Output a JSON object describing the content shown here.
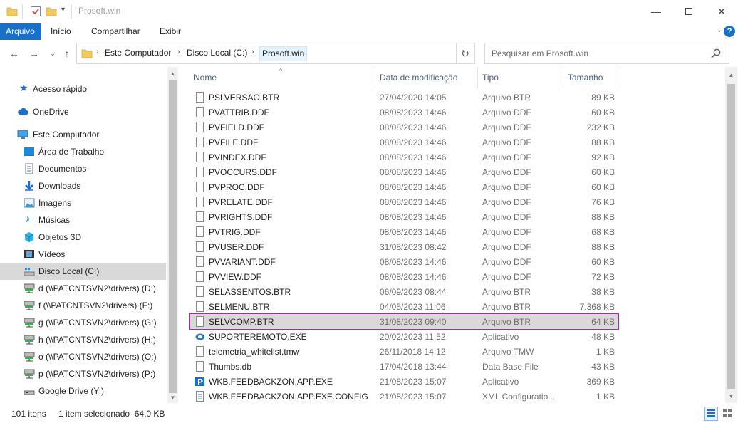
{
  "window": {
    "title": "Prosoft.win"
  },
  "ribbon": {
    "tabs": [
      "Arquivo",
      "Início",
      "Compartilhar",
      "Exibir"
    ]
  },
  "address": {
    "crumbs": [
      "Este Computador",
      "Disco Local (C:)",
      "Prosoft.win"
    ],
    "search_placeholder": "Pesquisar em Prosoft.win"
  },
  "nav": {
    "items": [
      {
        "label": "Acesso rápido",
        "icon": "star-icon"
      },
      {
        "label": "OneDrive",
        "icon": "cloud-icon"
      },
      {
        "label": "Este Computador",
        "icon": "computer-icon"
      },
      {
        "label": "Área de Trabalho",
        "icon": "desktop-icon"
      },
      {
        "label": "Documentos",
        "icon": "document-icon"
      },
      {
        "label": "Downloads",
        "icon": "download-icon"
      },
      {
        "label": "Imagens",
        "icon": "image-icon"
      },
      {
        "label": "Músicas",
        "icon": "music-icon"
      },
      {
        "label": "Objetos 3D",
        "icon": "cube-icon"
      },
      {
        "label": "Vídeos",
        "icon": "video-icon"
      },
      {
        "label": "Disco Local (C:)",
        "icon": "drive-icon"
      },
      {
        "label": "d (\\\\PATCNTSVN2\\drivers) (D:)",
        "icon": "network-drive-icon"
      },
      {
        "label": "f (\\\\PATCNTSVN2\\drivers) (F:)",
        "icon": "network-drive-icon"
      },
      {
        "label": "g (\\\\PATCNTSVN2\\drivers) (G:)",
        "icon": "network-drive-icon"
      },
      {
        "label": "h (\\\\PATCNTSVN2\\drivers) (H:)",
        "icon": "network-drive-icon"
      },
      {
        "label": "o (\\\\PATCNTSVN2\\drivers) (O:)",
        "icon": "network-drive-icon"
      },
      {
        "label": "p (\\\\PATCNTSVN2\\drivers) (P:)",
        "icon": "network-drive-icon"
      },
      {
        "label": "Google Drive (Y:)",
        "icon": "drive-icon"
      }
    ]
  },
  "columns": {
    "name": "Nome",
    "date": "Data de modificação",
    "type": "Tipo",
    "size": "Tamanho"
  },
  "files": [
    {
      "name": "PSLVERSAO.BTR",
      "date": "27/04/2020 14:05",
      "type": "Arquivo BTR",
      "size": "89 KB"
    },
    {
      "name": "PVATTRIB.DDF",
      "date": "08/08/2023 14:46",
      "type": "Arquivo DDF",
      "size": "60 KB"
    },
    {
      "name": "PVFIELD.DDF",
      "date": "08/08/2023 14:46",
      "type": "Arquivo DDF",
      "size": "232 KB"
    },
    {
      "name": "PVFILE.DDF",
      "date": "08/08/2023 14:46",
      "type": "Arquivo DDF",
      "size": "88 KB"
    },
    {
      "name": "PVINDEX.DDF",
      "date": "08/08/2023 14:46",
      "type": "Arquivo DDF",
      "size": "92 KB"
    },
    {
      "name": "PVOCCURS.DDF",
      "date": "08/08/2023 14:46",
      "type": "Arquivo DDF",
      "size": "60 KB"
    },
    {
      "name": "PVPROC.DDF",
      "date": "08/08/2023 14:46",
      "type": "Arquivo DDF",
      "size": "60 KB"
    },
    {
      "name": "PVRELATE.DDF",
      "date": "08/08/2023 14:46",
      "type": "Arquivo DDF",
      "size": "76 KB"
    },
    {
      "name": "PVRIGHTS.DDF",
      "date": "08/08/2023 14:46",
      "type": "Arquivo DDF",
      "size": "88 KB"
    },
    {
      "name": "PVTRIG.DDF",
      "date": "08/08/2023 14:46",
      "type": "Arquivo DDF",
      "size": "68 KB"
    },
    {
      "name": "PVUSER.DDF",
      "date": "31/08/2023 08:42",
      "type": "Arquivo DDF",
      "size": "88 KB"
    },
    {
      "name": "PVVARIANT.DDF",
      "date": "08/08/2023 14:46",
      "type": "Arquivo DDF",
      "size": "60 KB"
    },
    {
      "name": "PVVIEW.DDF",
      "date": "08/08/2023 14:46",
      "type": "Arquivo DDF",
      "size": "72 KB"
    },
    {
      "name": "SELASSENTOS.BTR",
      "date": "06/09/2023 08:44",
      "type": "Arquivo BTR",
      "size": "38 KB"
    },
    {
      "name": "SELMENU.BTR",
      "date": "04/05/2023 11:06",
      "type": "Arquivo BTR",
      "size": "7.368 KB"
    },
    {
      "name": "SELVCOMP.BTR",
      "date": "31/08/2023 09:40",
      "type": "Arquivo BTR",
      "size": "64 KB"
    },
    {
      "name": "SUPORTEREMOTO.EXE",
      "date": "20/02/2023 11:52",
      "type": "Aplicativo",
      "size": "48 KB"
    },
    {
      "name": "telemetria_whitelist.tmw",
      "date": "26/11/2018 14:12",
      "type": "Arquivo TMW",
      "size": "1 KB"
    },
    {
      "name": "Thumbs.db",
      "date": "17/04/2018 13:44",
      "type": "Data Base File",
      "size": "43 KB"
    },
    {
      "name": "WKB.FEEDBACKZON.APP.EXE",
      "date": "21/08/2023 15:07",
      "type": "Aplicativo",
      "size": "369 KB"
    },
    {
      "name": "WKB.FEEDBACKZON.APP.EXE.CONFIG",
      "date": "21/08/2023 15:07",
      "type": "XML Configuratio...",
      "size": "1 KB"
    }
  ],
  "selected_index": 15,
  "status": {
    "count": "101 itens",
    "selection": "1 item selecionado  64,0 KB"
  },
  "colors": {
    "accent": "#1a6fc7",
    "selection_outline": "#8e3c92",
    "selection_bg": "#d9d9d9"
  }
}
